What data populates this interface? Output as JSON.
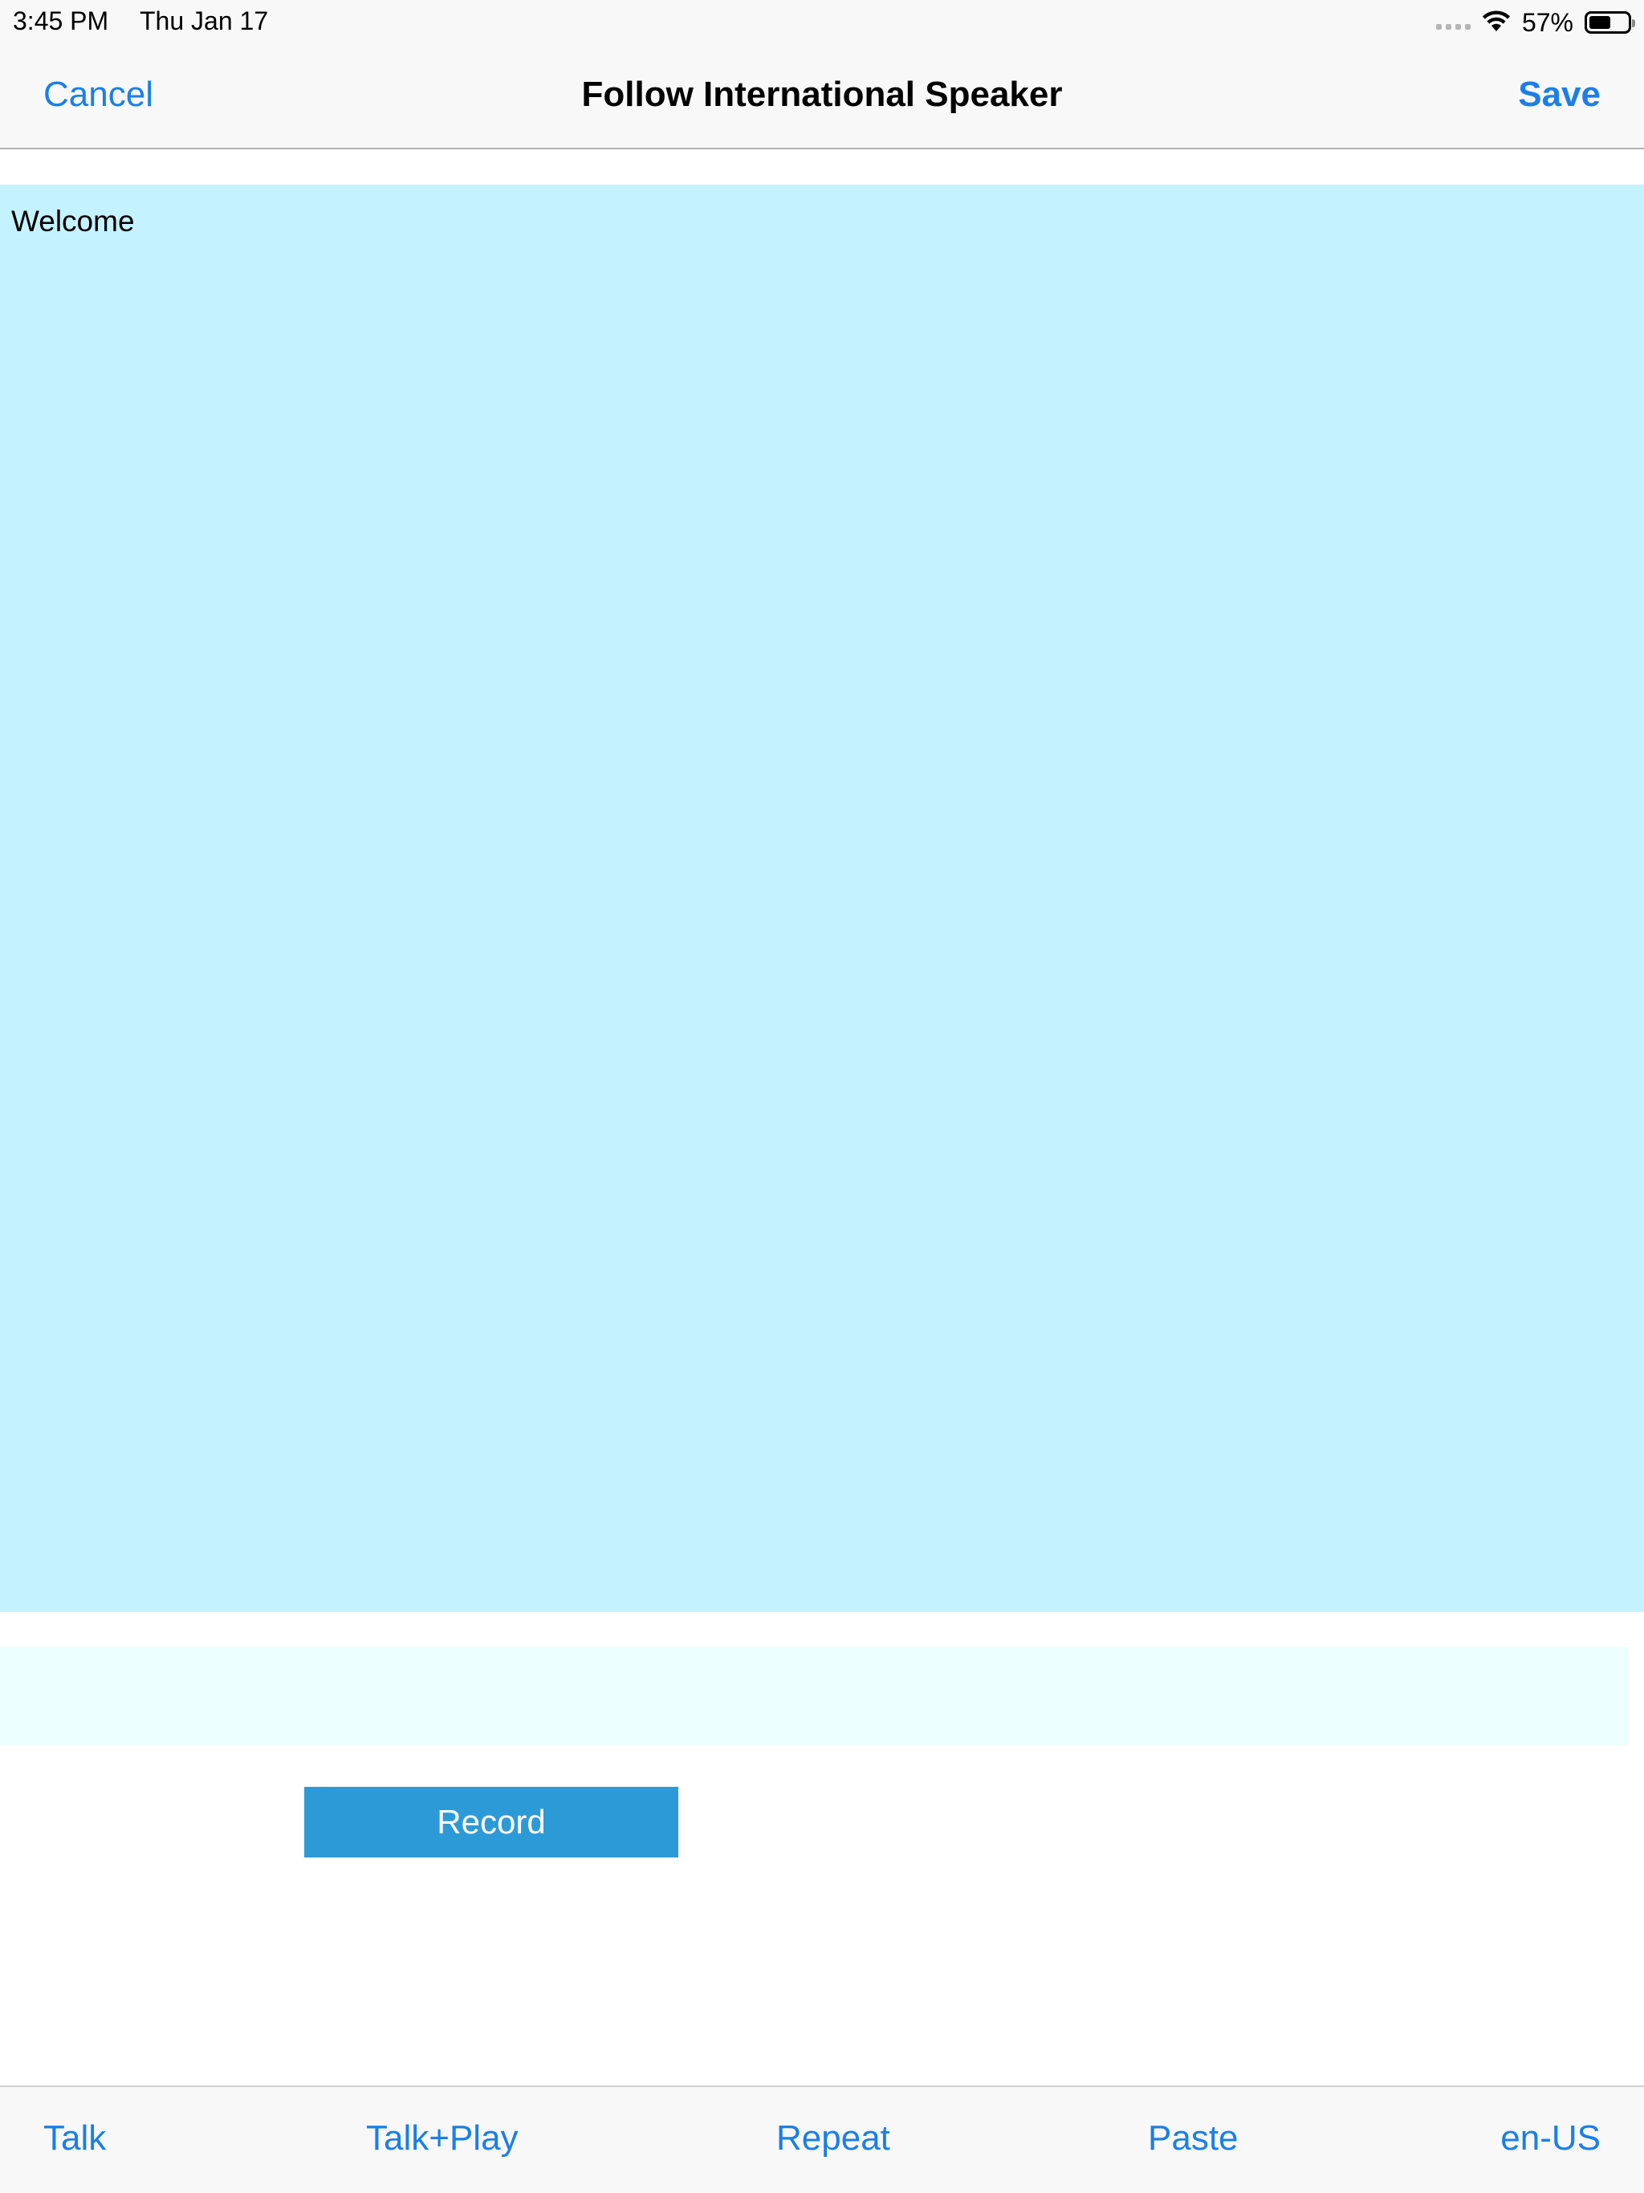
{
  "status_bar": {
    "time": "3:45 PM",
    "date": "Thu Jan 17",
    "battery_percent_label": "57%",
    "battery_level": 0.57,
    "icons": [
      "signal-dots-icon",
      "wifi-icon",
      "battery-icon"
    ]
  },
  "nav": {
    "cancel_label": "Cancel",
    "title": "Follow International Speaker",
    "save_label": "Save"
  },
  "main": {
    "text_content": "Welcome",
    "result_text": ""
  },
  "record_button": {
    "label": "Record"
  },
  "toolbar": {
    "items": [
      {
        "label": "Talk"
      },
      {
        "label": "Talk+Play"
      },
      {
        "label": "Repeat"
      },
      {
        "label": "Paste"
      },
      {
        "label": "en-US"
      }
    ]
  },
  "colors": {
    "accent": "#1b7fe6",
    "text_panel_bg": "#c4f2fe",
    "result_field_bg": "#ebfffd",
    "record_button_bg": "#2d9ad8",
    "bar_bg": "#f8f8f8"
  }
}
